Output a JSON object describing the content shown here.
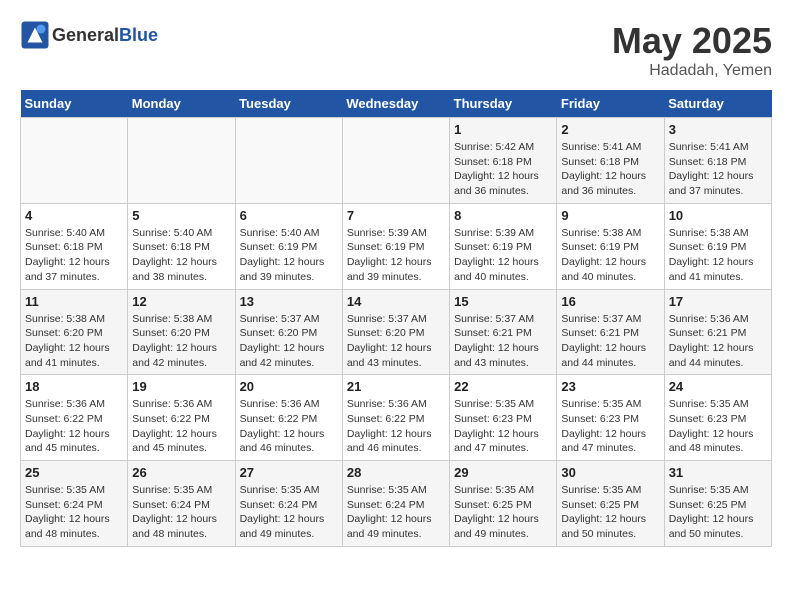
{
  "header": {
    "logo_general": "General",
    "logo_blue": "Blue",
    "month_year": "May 2025",
    "location": "Hadadah, Yemen"
  },
  "days_of_week": [
    "Sunday",
    "Monday",
    "Tuesday",
    "Wednesday",
    "Thursday",
    "Friday",
    "Saturday"
  ],
  "weeks": [
    [
      {
        "day": "",
        "empty": true
      },
      {
        "day": "",
        "empty": true
      },
      {
        "day": "",
        "empty": true
      },
      {
        "day": "",
        "empty": true
      },
      {
        "day": "1",
        "sunrise": "5:42 AM",
        "sunset": "6:18 PM",
        "daylight": "12 hours and 36 minutes."
      },
      {
        "day": "2",
        "sunrise": "5:41 AM",
        "sunset": "6:18 PM",
        "daylight": "12 hours and 36 minutes."
      },
      {
        "day": "3",
        "sunrise": "5:41 AM",
        "sunset": "6:18 PM",
        "daylight": "12 hours and 37 minutes."
      }
    ],
    [
      {
        "day": "4",
        "sunrise": "5:40 AM",
        "sunset": "6:18 PM",
        "daylight": "12 hours and 37 minutes."
      },
      {
        "day": "5",
        "sunrise": "5:40 AM",
        "sunset": "6:18 PM",
        "daylight": "12 hours and 38 minutes."
      },
      {
        "day": "6",
        "sunrise": "5:40 AM",
        "sunset": "6:19 PM",
        "daylight": "12 hours and 39 minutes."
      },
      {
        "day": "7",
        "sunrise": "5:39 AM",
        "sunset": "6:19 PM",
        "daylight": "12 hours and 39 minutes."
      },
      {
        "day": "8",
        "sunrise": "5:39 AM",
        "sunset": "6:19 PM",
        "daylight": "12 hours and 40 minutes."
      },
      {
        "day": "9",
        "sunrise": "5:38 AM",
        "sunset": "6:19 PM",
        "daylight": "12 hours and 40 minutes."
      },
      {
        "day": "10",
        "sunrise": "5:38 AM",
        "sunset": "6:19 PM",
        "daylight": "12 hours and 41 minutes."
      }
    ],
    [
      {
        "day": "11",
        "sunrise": "5:38 AM",
        "sunset": "6:20 PM",
        "daylight": "12 hours and 41 minutes."
      },
      {
        "day": "12",
        "sunrise": "5:38 AM",
        "sunset": "6:20 PM",
        "daylight": "12 hours and 42 minutes."
      },
      {
        "day": "13",
        "sunrise": "5:37 AM",
        "sunset": "6:20 PM",
        "daylight": "12 hours and 42 minutes."
      },
      {
        "day": "14",
        "sunrise": "5:37 AM",
        "sunset": "6:20 PM",
        "daylight": "12 hours and 43 minutes."
      },
      {
        "day": "15",
        "sunrise": "5:37 AM",
        "sunset": "6:21 PM",
        "daylight": "12 hours and 43 minutes."
      },
      {
        "day": "16",
        "sunrise": "5:37 AM",
        "sunset": "6:21 PM",
        "daylight": "12 hours and 44 minutes."
      },
      {
        "day": "17",
        "sunrise": "5:36 AM",
        "sunset": "6:21 PM",
        "daylight": "12 hours and 44 minutes."
      }
    ],
    [
      {
        "day": "18",
        "sunrise": "5:36 AM",
        "sunset": "6:22 PM",
        "daylight": "12 hours and 45 minutes."
      },
      {
        "day": "19",
        "sunrise": "5:36 AM",
        "sunset": "6:22 PM",
        "daylight": "12 hours and 45 minutes."
      },
      {
        "day": "20",
        "sunrise": "5:36 AM",
        "sunset": "6:22 PM",
        "daylight": "12 hours and 46 minutes."
      },
      {
        "day": "21",
        "sunrise": "5:36 AM",
        "sunset": "6:22 PM",
        "daylight": "12 hours and 46 minutes."
      },
      {
        "day": "22",
        "sunrise": "5:35 AM",
        "sunset": "6:23 PM",
        "daylight": "12 hours and 47 minutes."
      },
      {
        "day": "23",
        "sunrise": "5:35 AM",
        "sunset": "6:23 PM",
        "daylight": "12 hours and 47 minutes."
      },
      {
        "day": "24",
        "sunrise": "5:35 AM",
        "sunset": "6:23 PM",
        "daylight": "12 hours and 48 minutes."
      }
    ],
    [
      {
        "day": "25",
        "sunrise": "5:35 AM",
        "sunset": "6:24 PM",
        "daylight": "12 hours and 48 minutes."
      },
      {
        "day": "26",
        "sunrise": "5:35 AM",
        "sunset": "6:24 PM",
        "daylight": "12 hours and 48 minutes."
      },
      {
        "day": "27",
        "sunrise": "5:35 AM",
        "sunset": "6:24 PM",
        "daylight": "12 hours and 49 minutes."
      },
      {
        "day": "28",
        "sunrise": "5:35 AM",
        "sunset": "6:24 PM",
        "daylight": "12 hours and 49 minutes."
      },
      {
        "day": "29",
        "sunrise": "5:35 AM",
        "sunset": "6:25 PM",
        "daylight": "12 hours and 49 minutes."
      },
      {
        "day": "30",
        "sunrise": "5:35 AM",
        "sunset": "6:25 PM",
        "daylight": "12 hours and 50 minutes."
      },
      {
        "day": "31",
        "sunrise": "5:35 AM",
        "sunset": "6:25 PM",
        "daylight": "12 hours and 50 minutes."
      }
    ]
  ]
}
